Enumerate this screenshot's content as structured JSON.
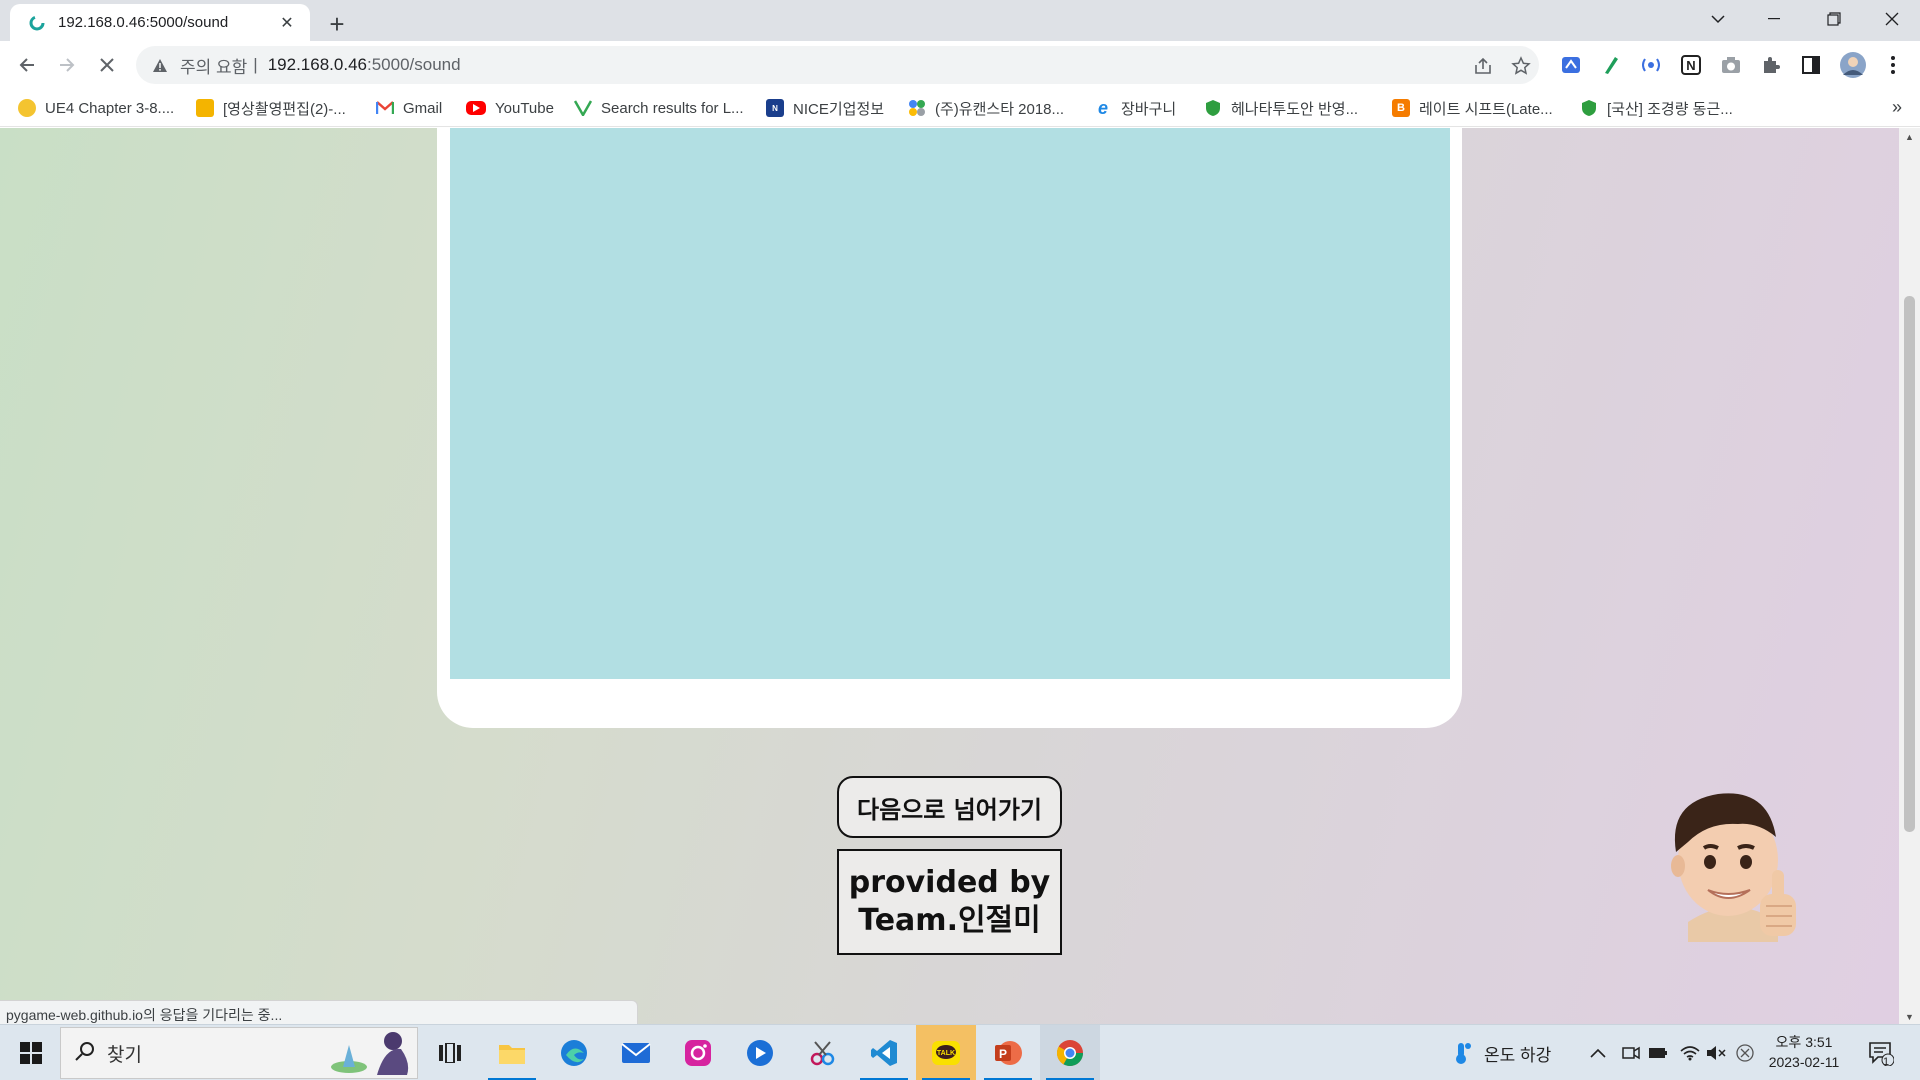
{
  "browser": {
    "tab": {
      "title": "192.168.0.46:5000/sound",
      "close_glyph": "✕"
    },
    "new_tab_glyph": "+",
    "omnibox": {
      "security_text": "주의 요함",
      "separator": "|",
      "host": "192.168.0.46",
      "path": ":5000/sound"
    },
    "bookmarks": [
      {
        "label": "UE4 Chapter 3-8....",
        "icon": "moon-icon",
        "color": "#f4b400"
      },
      {
        "label": "[영상촬영편집(2)-...",
        "icon": "classroom-icon",
        "color": "#f4b400"
      },
      {
        "label": "Gmail",
        "icon": "gmail-icon",
        "color": "#ea4335"
      },
      {
        "label": "YouTube",
        "icon": "youtube-icon",
        "color": "#ff0000"
      },
      {
        "label": "Search results for L...",
        "icon": "vee-icon",
        "color": "#34a853"
      },
      {
        "label": "NICE기업정보",
        "icon": "nice-icon",
        "color": "#1a3e8c"
      },
      {
        "label": "(주)유캔스타 2018...",
        "icon": "dots-icon",
        "color": "#4285f4"
      },
      {
        "label": "장바구니",
        "icon": "ie-icon",
        "color": "#1e88e5"
      },
      {
        "label": "헤나타투도안 반영...",
        "icon": "shield-icon",
        "color": "#2e9e3f"
      },
      {
        "label": "레이트 시프트(Late...",
        "icon": "blogger-icon",
        "color": "#f57c00"
      },
      {
        "label": "[국산] 조경량 동근...",
        "icon": "shield-icon",
        "color": "#2e9e3f"
      }
    ],
    "more_glyph": "»"
  },
  "page": {
    "next_button_label": "다음으로 넘어가기",
    "credit_line1": "provided by",
    "credit_line2": "Team.인절미",
    "status_text": "pygame-web.github.io의 응답을 기다리는 중..."
  },
  "taskbar": {
    "search_label": "찾기",
    "tray_weather": "온도 하강",
    "time": "오후 3:51",
    "date": "2023-02-11",
    "notification_count": "1"
  },
  "colors": {
    "game_canvas": "#b2dfe3",
    "page_gradient_start": "#c9dfc6",
    "page_gradient_end": "#e0cfe2"
  }
}
